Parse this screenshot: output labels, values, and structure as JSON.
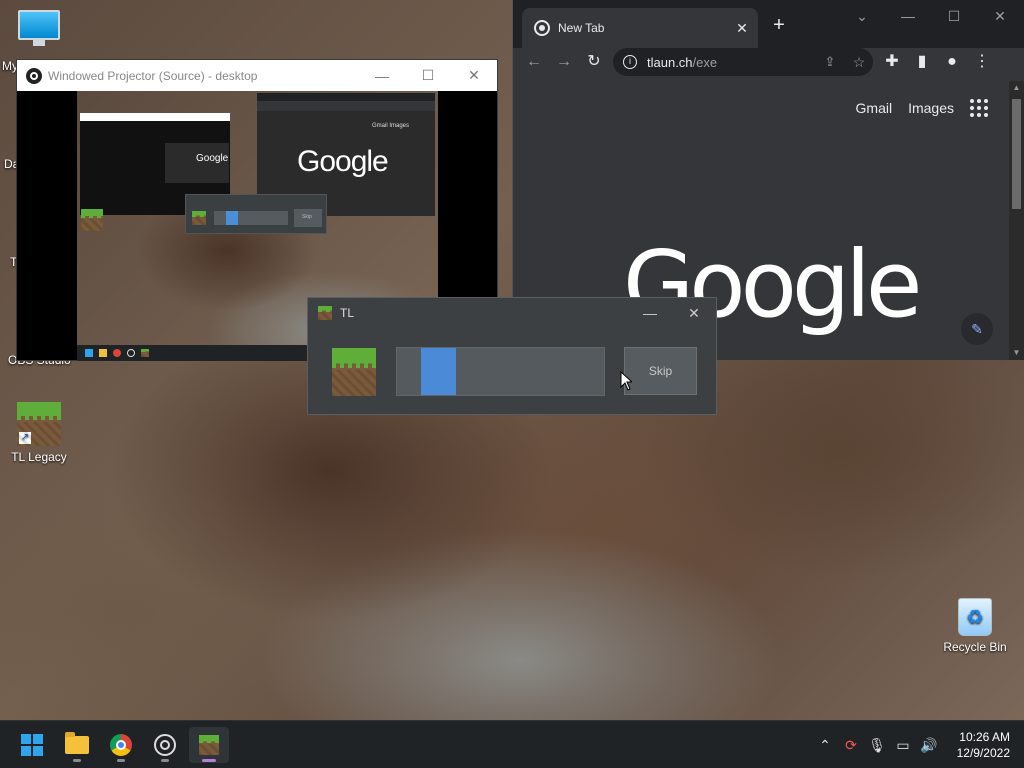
{
  "desktop": {
    "icons": [
      {
        "label": "My",
        "name": "this-pc"
      },
      {
        "label": "Da",
        "name": "partial-data"
      },
      {
        "label": "T",
        "name": "partial-t"
      },
      {
        "label": "OBS Studio",
        "name": "obs-studio"
      },
      {
        "label": "TL Legacy",
        "name": "tl-legacy"
      },
      {
        "label": "Recycle Bin",
        "name": "recycle-bin"
      }
    ]
  },
  "projector": {
    "title": "Windowed Projector (Source) - desktop",
    "mini_google": "Google",
    "mini_links": "Gmail  Images",
    "mini_skip": "Skip"
  },
  "chrome": {
    "tab_title": "New Tab",
    "url_host": "tlaun.ch",
    "url_path": "/exe",
    "links": {
      "gmail": "Gmail",
      "images": "Images"
    },
    "logo": "Google"
  },
  "tl_dialog": {
    "title": "TL",
    "progress": 0.17,
    "skip_label": "Skip",
    "accent": "#4a8ad6"
  },
  "taskbar": {
    "apps": [
      "start",
      "file-explorer",
      "chrome",
      "obs-studio",
      "tl-legacy"
    ],
    "time": "10:26 AM",
    "date": "12/9/2022"
  }
}
